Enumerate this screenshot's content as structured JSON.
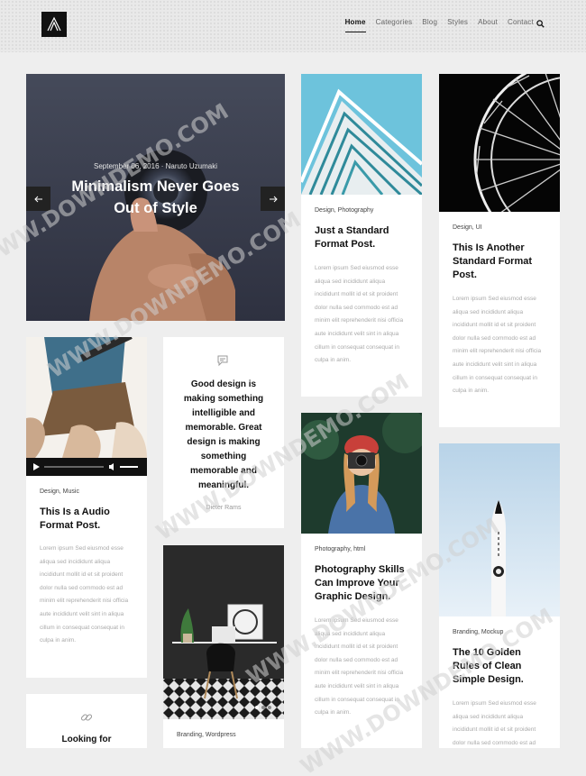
{
  "nav": {
    "items": [
      "Home",
      "Categories",
      "Blog",
      "Styles",
      "About",
      "Contact"
    ]
  },
  "icons": {
    "logo": "logo-a-icon",
    "search": "search-icon",
    "prev": "arrow-left-icon",
    "next": "arrow-right-icon",
    "quote": "chat-icon",
    "link": "link-icon"
  },
  "hero": {
    "meta": "September 06, 2016 · Naruto Uzumaki",
    "title": "Minimalism Never Goes Out of Style"
  },
  "excerpt": "Lorem ipsum Sed eiusmod esse aliqua sed incididunt aliqua incididunt mollit id et sit proident dolor nulla sed commodo est ad minim elit reprehenderit nisi officia aute incididunt velit sint in aliqua cillum in consequat consequat in culpa in anim.",
  "posts": {
    "building": {
      "cat": "Design, Photography",
      "title": "Just a Standard Format Post."
    },
    "ferris": {
      "cat": "Design, UI",
      "title": "This Is Another Standard Format Post."
    },
    "audio": {
      "cat": "Design, Music",
      "title": "This Is a Audio Format Post."
    },
    "quote": {
      "text": "Good design is making something intelligible and memorable. Great design is making something memorable and meaningful.",
      "author": "Dieter Rams"
    },
    "photo": {
      "cat": "Photography, html",
      "title": "Photography Skills Can Improve Your Graphic Design."
    },
    "rocket": {
      "cat": "Branding, Mockup",
      "title": "The 10 Golden Rules of Clean Simple Design."
    },
    "desk": {
      "cat": "Branding, Wordpress"
    },
    "link": {
      "title": "Looking for"
    }
  },
  "watermark": "WWW.DOWNDEMO.COM"
}
